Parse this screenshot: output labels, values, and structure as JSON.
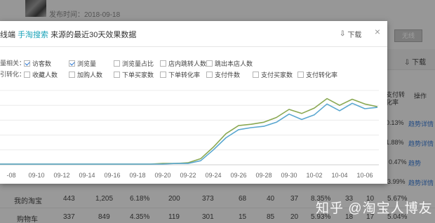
{
  "background": {
    "publish_time": "发布时间：2018-09-18",
    "btn_label": "无线",
    "download": "下载",
    "col_header": "支付转化率",
    "col_op": "操作",
    "side_cells": [
      {
        "rate": "0.13%",
        "trend": "趋势",
        "detail": "详情"
      },
      {
        "rate": "1.88%",
        "trend": "趋势",
        "detail": "详情"
      },
      {
        "rate": "0.47%",
        "trend": "趋势",
        "detail": "详情"
      },
      {
        "rate": "3.99%",
        "trend": "趋势",
        "detail": "详情"
      }
    ],
    "rows": [
      {
        "name": "我的淘宝",
        "v1": "443",
        "v2": "1,205",
        "v3": "6.18%",
        "v4": "200",
        "v5": "373",
        "v6": "68",
        "v7": "40",
        "v8": "37",
        "v9": "8.35%",
        "v10": "33",
        "v11": "10",
        "rate": "5.67%"
      },
      {
        "name": "购物车",
        "v1": "337",
        "v2": "849",
        "v3": "4.35%",
        "v4": "119",
        "v5": "301",
        "v6": "15",
        "v7": "85",
        "v8": "20",
        "v9": "5.93%",
        "v10": "18",
        "v11": "17",
        "rate": "5.04%"
      }
    ]
  },
  "modal": {
    "title_prefix": "线端",
    "title_link": "手淘搜索",
    "title_suffix": "来源的最近30天效果数据",
    "download": "下载",
    "close": "×",
    "row1_label": "量相关：",
    "row2_label": "引转化：",
    "row1_items": [
      {
        "label": "访客数",
        "checked": true
      },
      {
        "label": "浏览量",
        "checked": true
      },
      {
        "label": "浏览量占比",
        "checked": false
      },
      {
        "label": "店内跳转人数",
        "checked": false
      },
      {
        "label": "跳出本店人数",
        "checked": false
      }
    ],
    "row2_items": [
      {
        "label": "收藏人数",
        "checked": false
      },
      {
        "label": "加购人数",
        "checked": false
      },
      {
        "label": "下单买家数",
        "checked": false
      },
      {
        "label": "下单转化率",
        "checked": false
      },
      {
        "label": "支付件数",
        "checked": false
      },
      {
        "label": "支付买家数",
        "checked": false
      },
      {
        "label": "支付转化率",
        "checked": false
      }
    ]
  },
  "chart_data": {
    "type": "line",
    "x": [
      "09-07",
      "09-08",
      "09-09",
      "09-10",
      "09-11",
      "09-12",
      "09-13",
      "09-14",
      "09-15",
      "09-16",
      "09-17",
      "09-18",
      "09-19",
      "09-20",
      "09-21",
      "09-22",
      "09-23",
      "09-24",
      "09-25",
      "09-26",
      "09-27",
      "09-28",
      "09-29",
      "09-30",
      "10-01",
      "10-02",
      "10-03",
      "10-04",
      "10-05",
      "10-06",
      "10-07"
    ],
    "x_tick_labels": [
      "-08",
      "09-10",
      "09-12",
      "09-14",
      "09-16",
      "09-18",
      "09-20",
      "09-22",
      "09-24",
      "09-26",
      "09-28",
      "09-30",
      "10-02",
      "10-04",
      "10-06"
    ],
    "series": [
      {
        "color": "#8aa852",
        "values": [
          1,
          1,
          1,
          1,
          1,
          1,
          1,
          1,
          1,
          1,
          1,
          1,
          1,
          2,
          2,
          3,
          9,
          26,
          46,
          58,
          60,
          63,
          70,
          82,
          76,
          84,
          98,
          88,
          97,
          90,
          86
        ]
      },
      {
        "color": "#5aa7d0",
        "values": [
          1,
          1,
          1,
          1,
          1,
          1,
          1,
          1,
          1,
          1,
          1,
          1,
          1,
          1,
          2,
          2,
          6,
          22,
          40,
          52,
          55,
          57,
          63,
          75,
          67,
          74,
          90,
          80,
          91,
          83,
          85
        ]
      }
    ],
    "ylim": [
      0,
      110
    ],
    "grid": true,
    "legend": "none"
  },
  "watermark": "知乎 @淘宝人博友"
}
